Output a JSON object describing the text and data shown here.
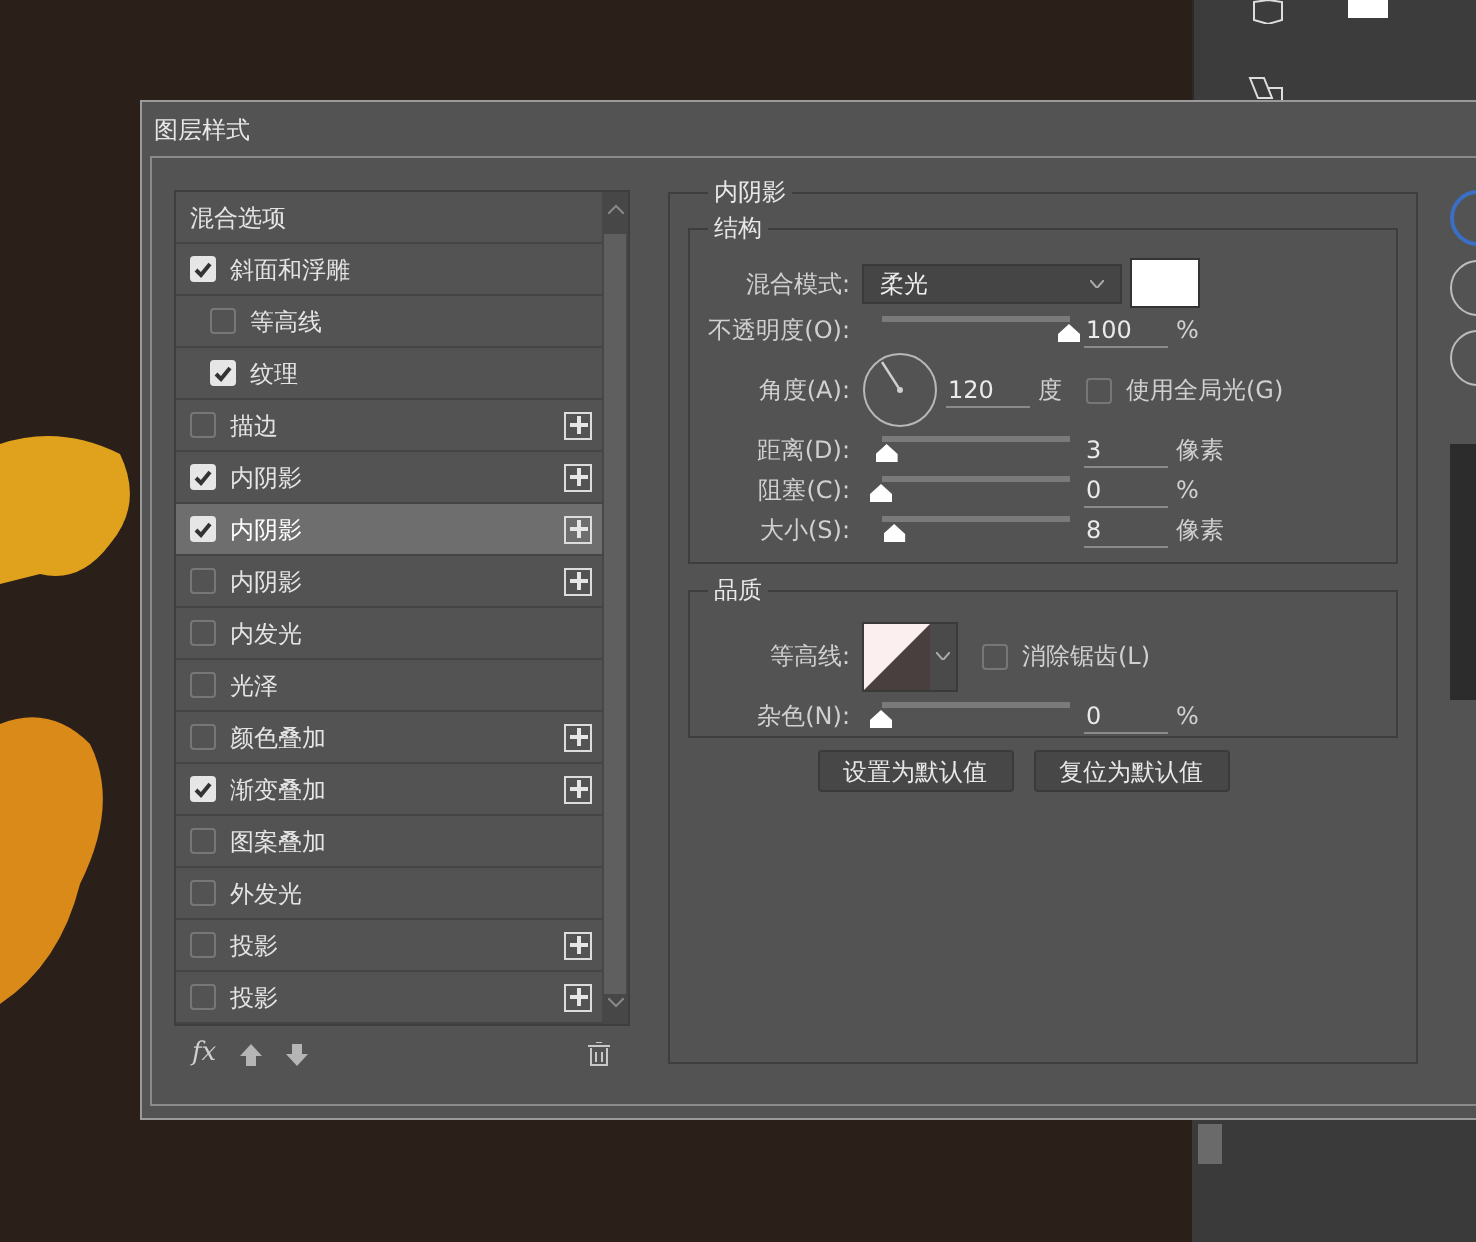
{
  "window": {
    "title": "图层样式"
  },
  "styles_list": {
    "items": [
      {
        "kind": "header",
        "label": "混合选项",
        "selected": false
      },
      {
        "kind": "effect",
        "label": "斜面和浮雕",
        "checked": true,
        "selected": false,
        "addable": false,
        "children": [
          {
            "kind": "effect",
            "label": "等高线",
            "checked": false,
            "selected": false,
            "addable": false
          },
          {
            "kind": "effect",
            "label": "纹理",
            "checked": true,
            "selected": false,
            "addable": false
          }
        ]
      },
      {
        "kind": "effect",
        "label": "描边",
        "checked": false,
        "selected": false,
        "addable": true
      },
      {
        "kind": "effect",
        "label": "内阴影",
        "checked": true,
        "selected": false,
        "addable": true
      },
      {
        "kind": "effect",
        "label": "内阴影",
        "checked": true,
        "selected": true,
        "addable": true
      },
      {
        "kind": "effect",
        "label": "内阴影",
        "checked": false,
        "selected": false,
        "addable": true
      },
      {
        "kind": "effect",
        "label": "内发光",
        "checked": false,
        "selected": false,
        "addable": false
      },
      {
        "kind": "effect",
        "label": "光泽",
        "checked": false,
        "selected": false,
        "addable": false
      },
      {
        "kind": "effect",
        "label": "颜色叠加",
        "checked": false,
        "selected": false,
        "addable": true
      },
      {
        "kind": "effect",
        "label": "渐变叠加",
        "checked": true,
        "selected": false,
        "addable": true
      },
      {
        "kind": "effect",
        "label": "图案叠加",
        "checked": false,
        "selected": false,
        "addable": false
      },
      {
        "kind": "effect",
        "label": "外发光",
        "checked": false,
        "selected": false,
        "addable": false
      },
      {
        "kind": "effect",
        "label": "投影",
        "checked": false,
        "selected": false,
        "addable": true
      },
      {
        "kind": "effect",
        "label": "投影",
        "checked": false,
        "selected": false,
        "addable": true
      }
    ],
    "toolbar": {
      "fx_button": "fx"
    }
  },
  "panel": {
    "title": "内阴影",
    "structure": {
      "title": "结构",
      "rows": [
        {
          "kind": "select",
          "label": "混合模式:",
          "value": "柔光"
        },
        {
          "kind": "slider",
          "label": "不透明度(O):",
          "level": 1,
          "value": "100",
          "unit": "%"
        },
        {
          "kind": "angle",
          "label": "角度(A):",
          "value": "120",
          "unit": "度",
          "option": {
            "label": "使用全局光(G)",
            "checked": false
          }
        },
        {
          "kind": "slider",
          "label": "距离(D):",
          "level": 0.03,
          "value": "3",
          "unit": "像素"
        },
        {
          "kind": "slider",
          "label": "阻塞(C):",
          "level": 0,
          "value": "0",
          "unit": "%"
        },
        {
          "kind": "slider",
          "label": "大小(S):",
          "level": 0.07,
          "value": "8",
          "unit": "像素"
        }
      ]
    },
    "quality": {
      "title": "品质",
      "rows": [
        {
          "kind": "contour",
          "label": "等高线:",
          "option": {
            "label": "消除锯齿(L)",
            "checked": false
          }
        },
        {
          "kind": "slider",
          "label": "杂色(N):",
          "level": 0,
          "value": "0",
          "unit": "%"
        }
      ]
    },
    "buttons": [
      "设置为默认值",
      "复位为默认值"
    ]
  }
}
